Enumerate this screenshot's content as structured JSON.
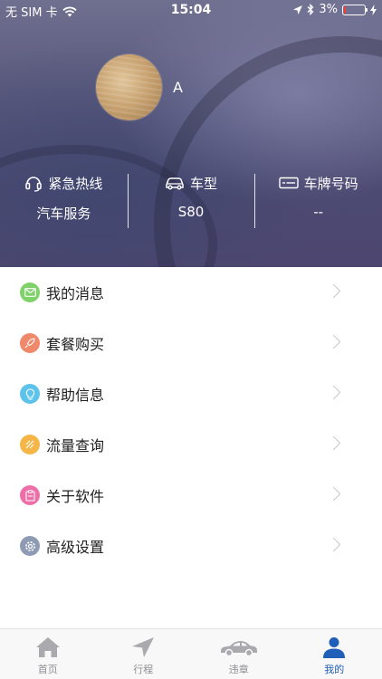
{
  "status_bar": {
    "carrier": "无 SIM 卡",
    "time": "15:04",
    "battery": "3%",
    "battery_level": 0.03
  },
  "profile": {
    "username": "A"
  },
  "info": [
    {
      "label": "紧急热线",
      "value": "汽车服务",
      "icon": "headset-icon"
    },
    {
      "label": "车型",
      "value": "S80",
      "icon": "car-icon"
    },
    {
      "label": "车牌号码",
      "value": "--",
      "icon": "license-plate-icon"
    }
  ],
  "menu": {
    "items": [
      {
        "label": "我的消息",
        "icon": "envelope-icon",
        "color": "#7fd26a"
      },
      {
        "label": "套餐购买",
        "icon": "rocket-icon",
        "color": "#f0886a"
      },
      {
        "label": "帮助信息",
        "icon": "lightbulb-icon",
        "color": "#5ec3ea"
      },
      {
        "label": "流量查询",
        "icon": "signal-icon",
        "color": "#f5b647"
      },
      {
        "label": "关于软件",
        "icon": "clipboard-icon",
        "color": "#ee6fa7"
      },
      {
        "label": "高级设置",
        "icon": "gear-icon",
        "color": "#8f9bb5"
      }
    ]
  },
  "tabbar": {
    "tabs": [
      {
        "label": "首页",
        "icon": "home-icon"
      },
      {
        "label": "行程",
        "icon": "navigation-arrow-icon"
      },
      {
        "label": "违章",
        "icon": "car-icon"
      },
      {
        "label": "我的",
        "icon": "person-icon",
        "active": true
      }
    ],
    "active_color": "#1f5fb8",
    "inactive_color": "#a9a9ae"
  }
}
